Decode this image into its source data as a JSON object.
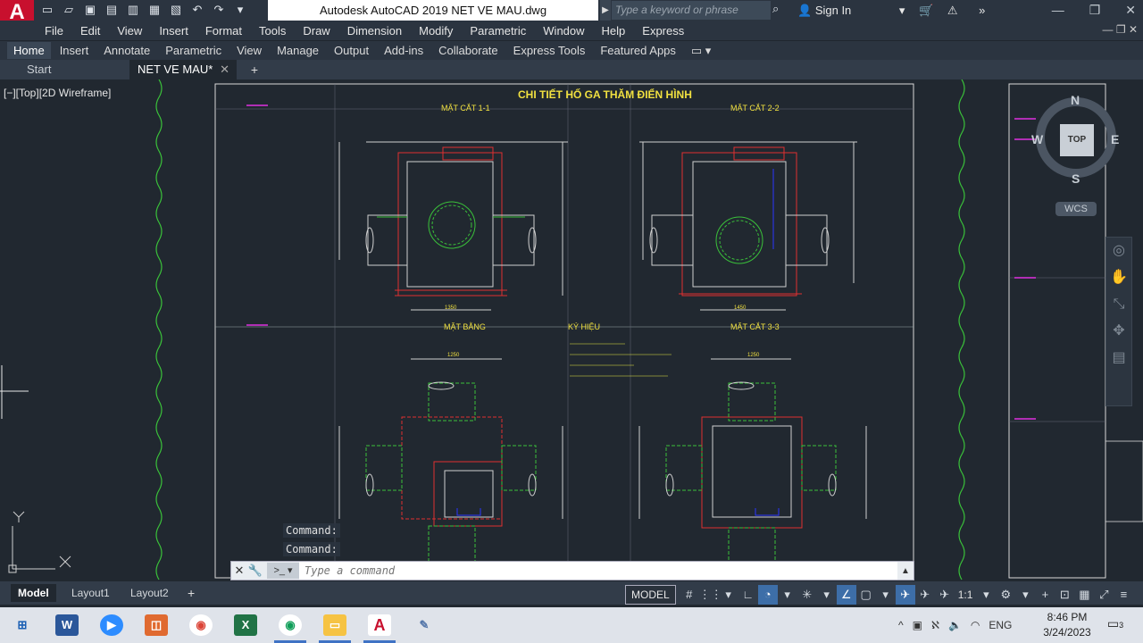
{
  "app": {
    "logo_letter": "A",
    "title": "Autodesk AutoCAD 2019    NET VE MAU.dwg",
    "search_placeholder": "Type a keyword or phrase",
    "sign_in": "Sign In"
  },
  "menu": [
    "File",
    "Edit",
    "View",
    "Insert",
    "Format",
    "Tools",
    "Draw",
    "Dimension",
    "Modify",
    "Parametric",
    "Window",
    "Help",
    "Express"
  ],
  "ribbon_tabs": [
    "Home",
    "Insert",
    "Annotate",
    "Parametric",
    "View",
    "Manage",
    "Output",
    "Add-ins",
    "Collaborate",
    "Express Tools",
    "Featured Apps"
  ],
  "doc_tabs": {
    "start": "Start",
    "current": "NET VE MAU*"
  },
  "viewport": {
    "label": "[−][Top][2D Wireframe]"
  },
  "drawing": {
    "title": "CHI TIẾT HỐ GA THĂM ĐIỂN HÌNH",
    "section_1": "MẶT CẮT 1-1",
    "section_2": "MẶT CẮT 2-2",
    "section_3": "MẶT CẮT 3-3",
    "plan": "MẶT BẰNG",
    "legend_title": "KÝ HIỆU",
    "dim_left_top": "1350",
    "dim_right_top": "1450",
    "dim_plan": "1250",
    "dim_plan_right": "1250"
  },
  "viewcube": {
    "n": "N",
    "s": "S",
    "e": "E",
    "w": "W",
    "face": "TOP",
    "wcs": "WCS"
  },
  "command": {
    "history": [
      "Command:",
      "Command:"
    ],
    "placeholder": "Type a command"
  },
  "layout_tabs": [
    "Model",
    "Layout1",
    "Layout2"
  ],
  "status": {
    "model": "MODEL",
    "scale": "1:1"
  },
  "taskbar": {
    "language": "ENG",
    "time": "8:46 PM",
    "date": "3/24/2023",
    "notifications": "3"
  },
  "colors": {
    "accent": "#c8102e",
    "background": "#212830",
    "chrome": "#2b3440"
  }
}
